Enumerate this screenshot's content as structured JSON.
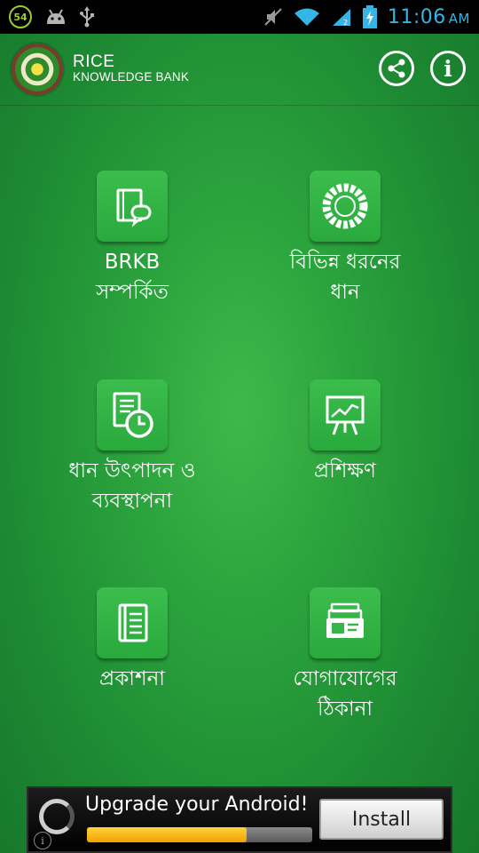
{
  "status_bar": {
    "notification_count": "54",
    "time": "11:06",
    "ampm": "AM"
  },
  "header": {
    "title_line1": "RICE",
    "title_line2": "KNOWLEDGE BANK"
  },
  "menu": {
    "items": [
      {
        "label": "BRKB\nসম্পর্কিত",
        "icon": "document-chat-icon"
      },
      {
        "label": "বিভিন্ন ধরনের\nধান",
        "icon": "rice-ring-icon"
      },
      {
        "label": "ধান উৎপাদন ও\nব্যবস্থাপনা",
        "icon": "document-clock-icon"
      },
      {
        "label": "প্রশিক্ষণ",
        "icon": "presentation-board-icon"
      },
      {
        "label": "প্রকাশনা",
        "icon": "book-icon"
      },
      {
        "label": "যোগাযোগের\nঠিকানা",
        "icon": "address-card-file-icon"
      }
    ]
  },
  "ad": {
    "text": "Upgrade your Android!",
    "button_label": "Install",
    "progress": 0.71
  },
  "colors": {
    "status_clock": "#35b5e5",
    "tile_green": "#33b346",
    "background_green": "#2aa23c"
  }
}
